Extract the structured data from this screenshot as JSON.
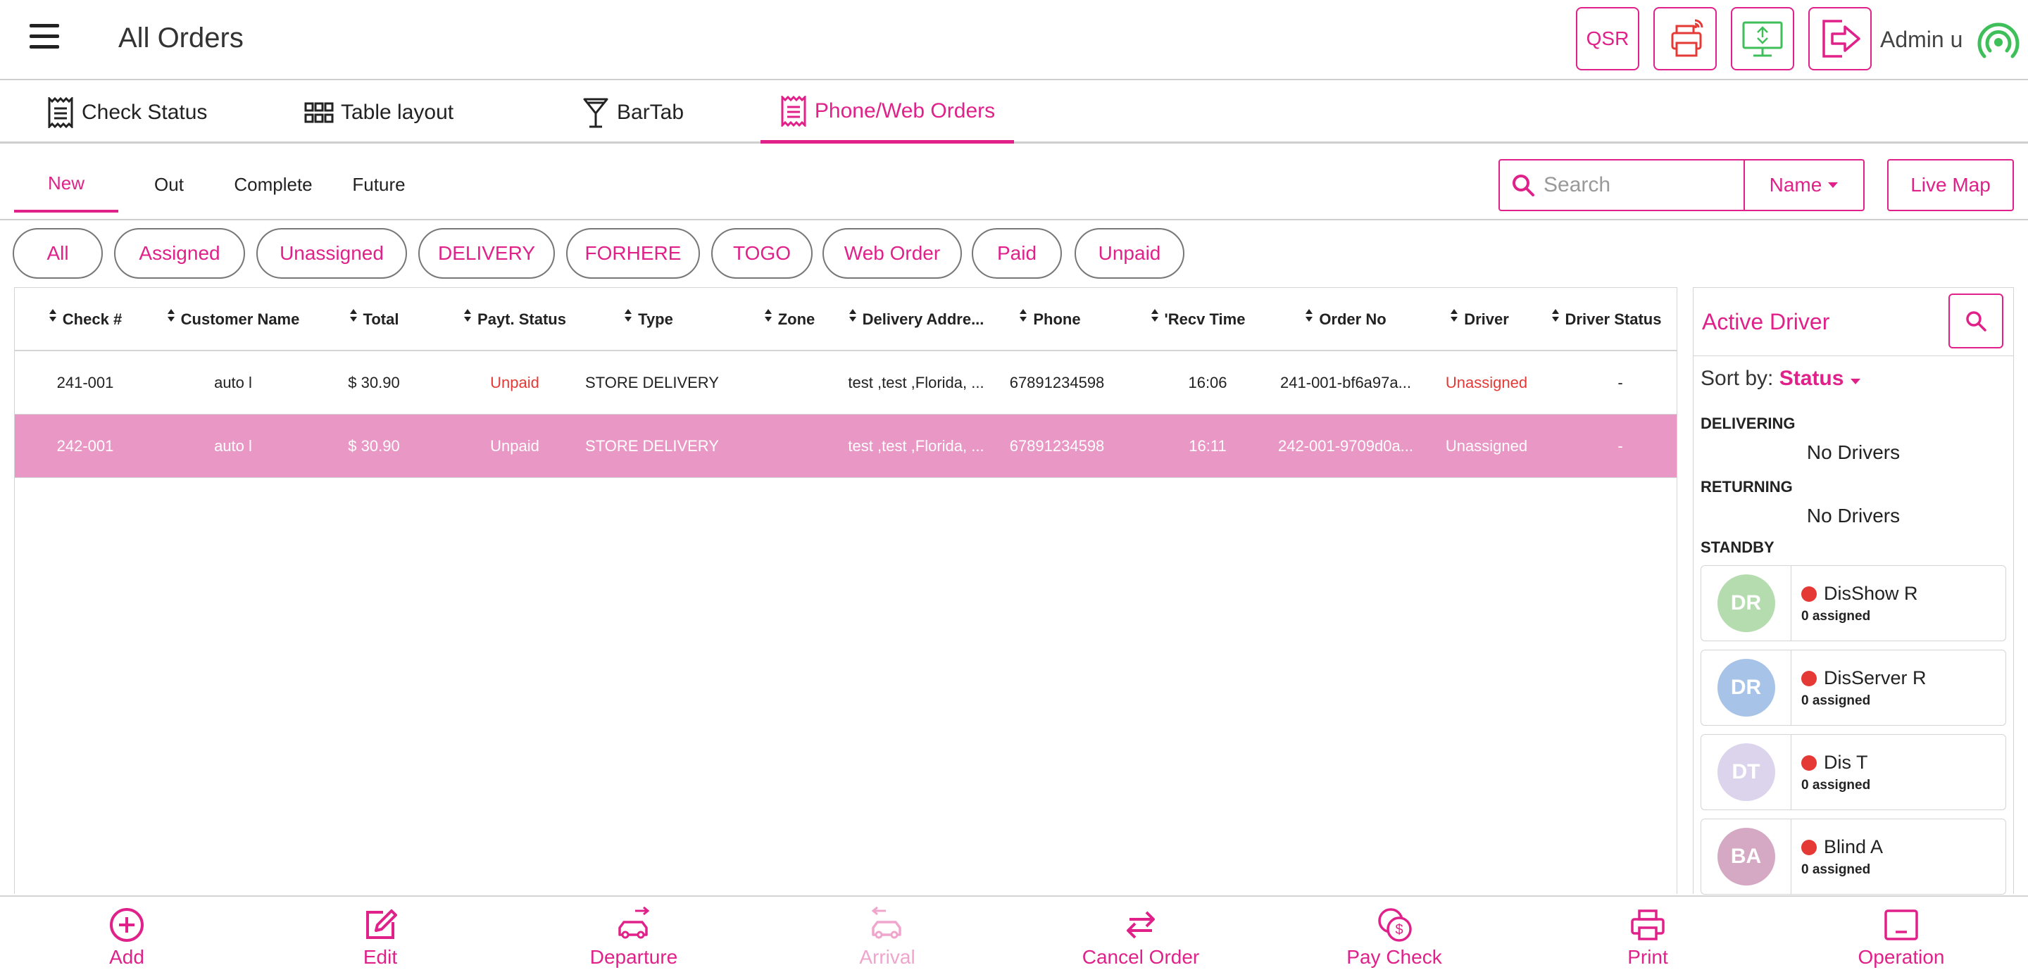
{
  "header": {
    "title": "All Orders",
    "qsr_label": "QSR",
    "user_label": "Admin u"
  },
  "main_tabs": [
    {
      "label": "Check Status",
      "icon": "receipt-icon"
    },
    {
      "label": "Table layout",
      "icon": "grid-icon"
    },
    {
      "label": "BarTab",
      "icon": "cocktail-icon"
    },
    {
      "label": "Phone/Web Orders",
      "icon": "receipt-icon",
      "active": true
    }
  ],
  "sub_tabs": [
    {
      "label": "New",
      "active": true
    },
    {
      "label": "Out"
    },
    {
      "label": "Complete"
    },
    {
      "label": "Future"
    }
  ],
  "search": {
    "placeholder": "Search",
    "field_label": "Name"
  },
  "live_map_label": "Live Map",
  "filters": [
    "All",
    "Assigned",
    "Unassigned",
    "DELIVERY",
    "FORHERE",
    "TOGO",
    "Web Order",
    "Paid",
    "Unpaid"
  ],
  "table": {
    "columns": [
      "Check #",
      "Customer Name",
      "Total",
      "Payt. Status",
      "Type",
      "Zone",
      "Delivery Addre...",
      "Phone",
      "'Recv Time",
      "Order No",
      "Driver",
      "Driver Status"
    ],
    "rows": [
      {
        "check": "241-001",
        "customer": "auto l",
        "total": "$ 30.90",
        "payt_status": "Unpaid",
        "type": "STORE DELIVERY",
        "zone": "",
        "address": "test ,test ,Florida, ...",
        "phone": "67891234598",
        "recv_time": "16:06",
        "order_no": "241-001-bf6a97a...",
        "driver": "Unassigned",
        "driver_status": "-"
      },
      {
        "check": "242-001",
        "customer": "auto l",
        "total": "$ 30.90",
        "payt_status": "Unpaid",
        "type": "STORE DELIVERY",
        "zone": "",
        "address": "test ,test ,Florida, ...",
        "phone": "67891234598",
        "recv_time": "16:11",
        "order_no": "242-001-9709d0a...",
        "driver": "Unassigned",
        "driver_status": "-",
        "selected": true
      }
    ]
  },
  "drivers_panel": {
    "title": "Active Driver",
    "sort_label": "Sort by:",
    "sort_value": "Status",
    "sections": {
      "delivering": {
        "label": "DELIVERING",
        "empty": "No Drivers"
      },
      "returning": {
        "label": "RETURNING",
        "empty": "No Drivers"
      },
      "standby": {
        "label": "STANDBY"
      }
    },
    "standby_drivers": [
      {
        "initials": "DR",
        "name": "DisShow R",
        "assigned": "0 assigned",
        "color": "#b5dcae"
      },
      {
        "initials": "DR",
        "name": "DisServer R",
        "assigned": "0 assigned",
        "color": "#a7c4e8"
      },
      {
        "initials": "DT",
        "name": "Dis T",
        "assigned": "0 assigned",
        "color": "#dcd4ec"
      },
      {
        "initials": "BA",
        "name": "Blind A",
        "assigned": "0 assigned",
        "color": "#d5a9c4"
      }
    ]
  },
  "toolbar": [
    {
      "label": "Add",
      "icon": "plus-circle-icon"
    },
    {
      "label": "Edit",
      "icon": "edit-icon"
    },
    {
      "label": "Departure",
      "icon": "car-departure-icon"
    },
    {
      "label": "Arrival",
      "icon": "car-arrival-icon",
      "disabled": true
    },
    {
      "label": "Cancel Order",
      "icon": "swap-arrows-icon"
    },
    {
      "label": "Pay Check",
      "icon": "coins-icon"
    },
    {
      "label": "Print",
      "icon": "printer-icon"
    },
    {
      "label": "Operation",
      "icon": "operation-icon"
    }
  ],
  "colors": {
    "accent": "#e0218a",
    "selected_row": "#e997c5",
    "unpaid": "#e53935",
    "status_online": "#3fbf5a"
  }
}
